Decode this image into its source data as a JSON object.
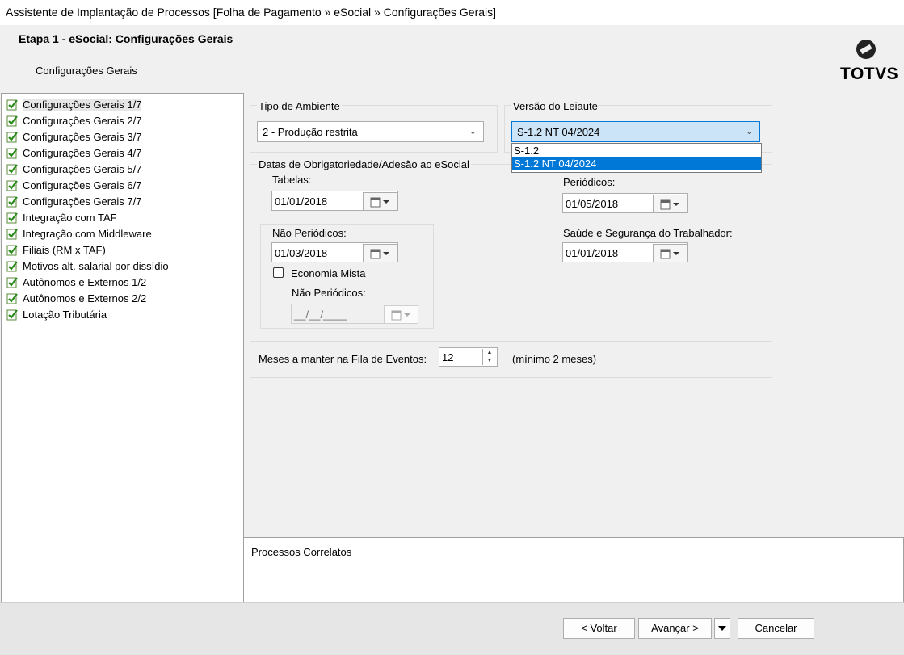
{
  "window": {
    "title": "Assistente de Implantação de Processos [Folha de Pagamento » eSocial » Configurações Gerais]"
  },
  "header": {
    "stage_title": "Etapa 1 - eSocial: Configurações Gerais",
    "subtitle": "Configurações Gerais",
    "logo_text": "TOTVS"
  },
  "sidebar": {
    "items": [
      {
        "label": "Configurações Gerais 1/7"
      },
      {
        "label": "Configurações Gerais 2/7"
      },
      {
        "label": "Configurações Gerais 3/7"
      },
      {
        "label": "Configurações Gerais 4/7"
      },
      {
        "label": "Configurações Gerais 5/7"
      },
      {
        "label": "Configurações Gerais 6/7"
      },
      {
        "label": "Configurações Gerais 7/7"
      },
      {
        "label": "Integração com TAF"
      },
      {
        "label": "Integração com Middleware"
      },
      {
        "label": "Filiais (RM x TAF)"
      },
      {
        "label": "Motivos alt. salarial por dissídio"
      },
      {
        "label": "Autônomos e Externos 1/2"
      },
      {
        "label": "Autônomos e Externos 2/2"
      },
      {
        "label": "Lotação Tributária"
      }
    ]
  },
  "ambiente": {
    "label": "Tipo de Ambiente",
    "value": "2 - Produção restrita"
  },
  "leiaute": {
    "label": "Versão do Leiaute",
    "value": "S-1.2 NT 04/2024",
    "options": [
      "S-1.2",
      "S-1.2 NT 04/2024"
    ]
  },
  "datas": {
    "label": "Datas de Obrigatoriedade/Adesão ao eSocial",
    "tabelas_label": "Tabelas:",
    "tabelas_value": "01/01/2018",
    "periodicos_label": "Periódicos:",
    "periodicos_value": "01/05/2018",
    "nao_periodicos_label": "Não Periódicos:",
    "nao_periodicos_value": "01/03/2018",
    "economia_mista_label": "Economia Mista",
    "em_nao_periodicos_label": "Não Periódicos:",
    "em_nao_periodicos_value": "__/__/____",
    "sst_label": "Saúde e Segurança do Trabalhador:",
    "sst_value": "01/01/2018"
  },
  "fila": {
    "label": "Meses a manter na Fila de Eventos:",
    "value": "12",
    "hint": "(mínimo 2 meses)"
  },
  "correlatos": {
    "label": "Processos Correlatos"
  },
  "footer": {
    "voltar": "< Voltar",
    "avancar": "Avançar >",
    "cancelar": "Cancelar"
  }
}
